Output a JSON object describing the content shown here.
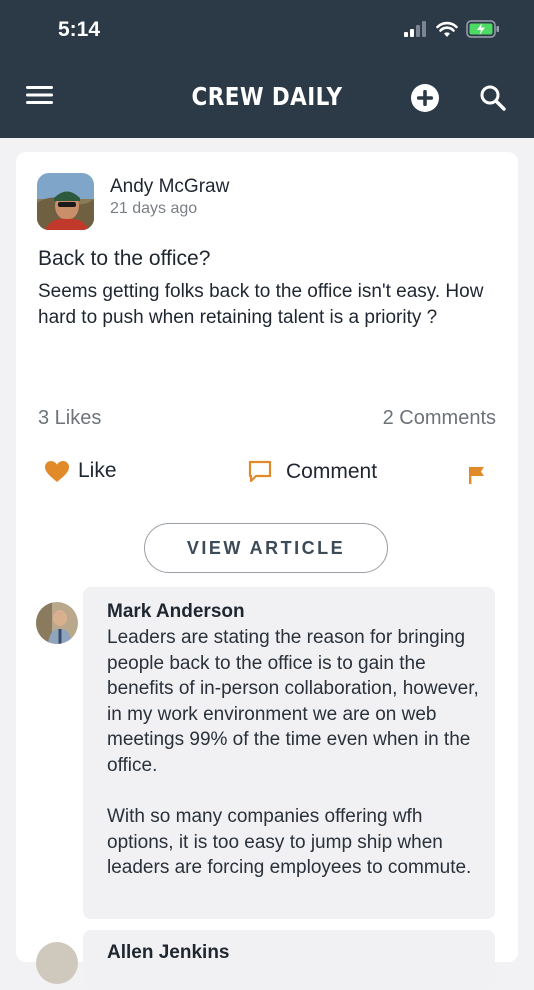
{
  "status_bar": {
    "time": "5:14"
  },
  "nav": {
    "title": "CREW DAILY",
    "icons": {
      "menu": "menu-icon",
      "add": "add-circle-icon",
      "search": "search-icon"
    }
  },
  "post": {
    "author": "Andy McGraw",
    "time_ago": "21 days ago",
    "title": "Back to the office?",
    "body": "Seems getting folks back to the office isn't easy. How hard to push when retaining talent is a priority ?",
    "likes": "3 Likes",
    "comments": "2 Comments",
    "actions": {
      "like": "Like",
      "comment": "Comment"
    },
    "view_article": "VIEW ARTICLE"
  },
  "comments": [
    {
      "author": "Mark Anderson",
      "text": "Leaders are stating the reason for bringing people back to the office is to gain the benefits of in-person collaboration,  however,  in my work environment we are on web meetings 99% of the time even when in the office.\n\nWith so many companies offering wfh options, it is too easy to jump ship when leaders are forcing employees to commute."
    },
    {
      "author": "Allen Jenkins"
    }
  ],
  "colors": {
    "header_bg": "#2c3a48",
    "accent": "#e08a2a",
    "heart": "#e08a2a"
  }
}
